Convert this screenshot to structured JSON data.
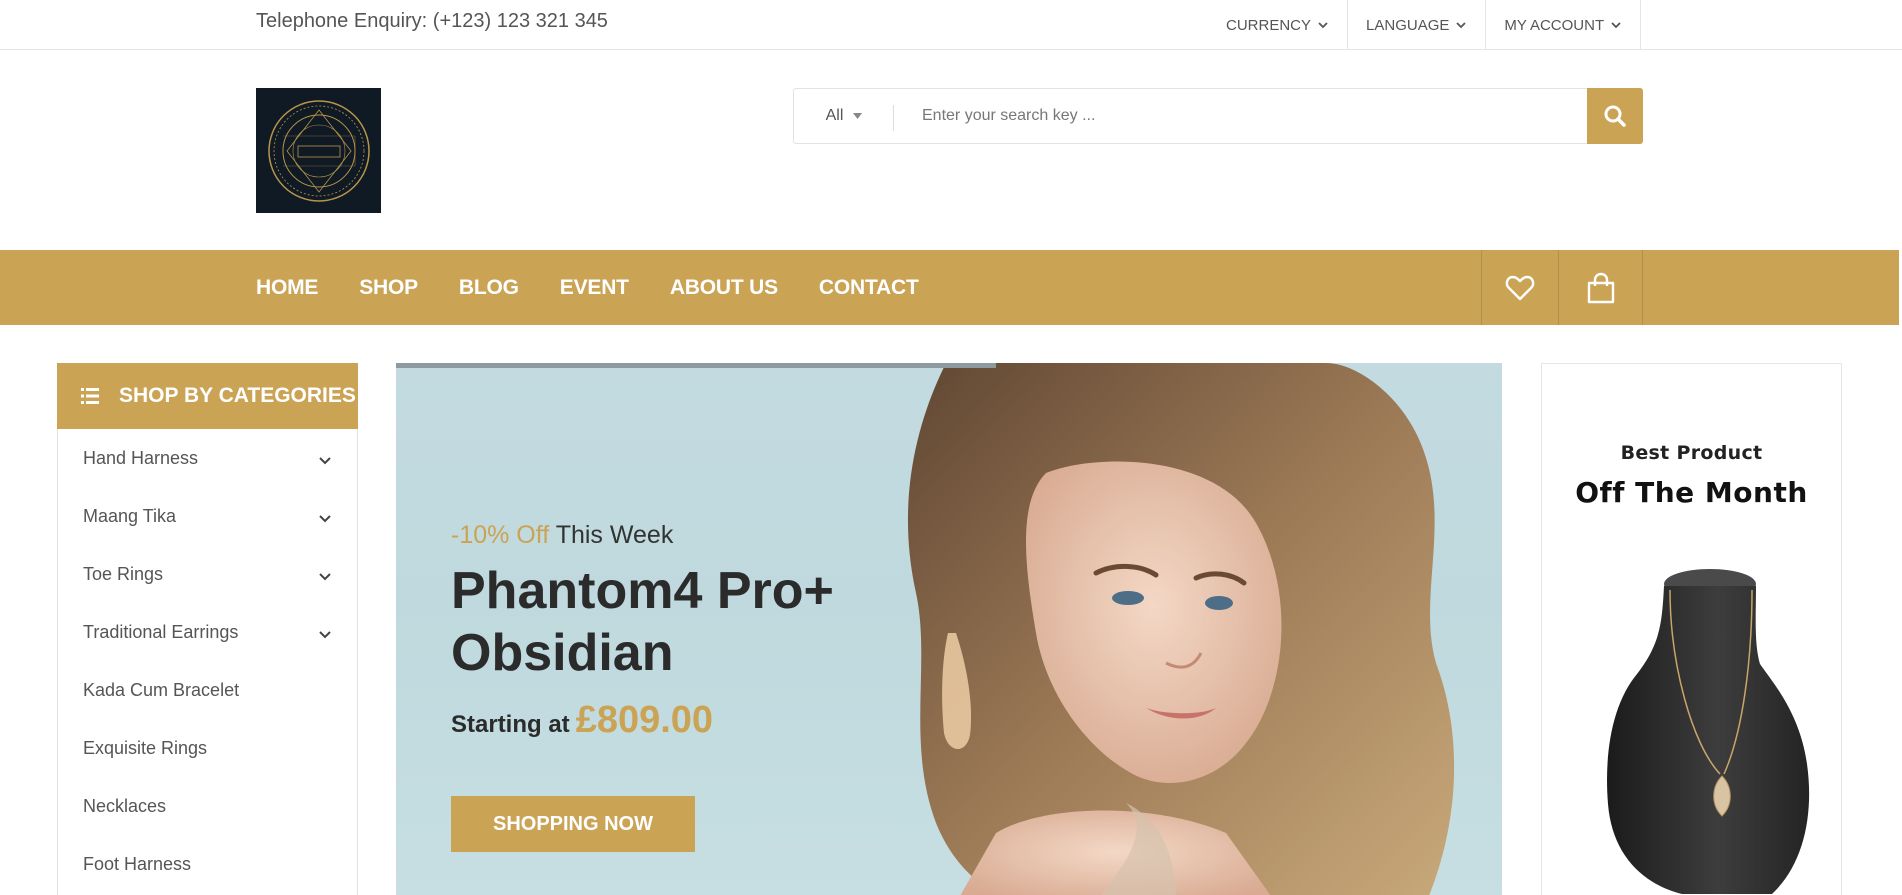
{
  "topbar": {
    "phone": "Telephone Enquiry: (+123) 123 321 345",
    "menus": [
      "CURRENCY",
      "LANGUAGE",
      "MY ACCOUNT"
    ]
  },
  "header": {
    "search": {
      "category": "All",
      "placeholder": "Enter your search key ..."
    }
  },
  "nav": {
    "items": [
      "HOME",
      "SHOP",
      "BLOG",
      "EVENT",
      "ABOUT US",
      "CONTACT"
    ]
  },
  "sidebar": {
    "title": "SHOP BY CATEGORIES",
    "items": [
      {
        "label": "Hand Harness",
        "has_children": true
      },
      {
        "label": "Maang Tika",
        "has_children": true
      },
      {
        "label": "Toe Rings",
        "has_children": true
      },
      {
        "label": "Traditional Earrings",
        "has_children": true
      },
      {
        "label": "Kada Cum Bracelet",
        "has_children": false
      },
      {
        "label": "Exquisite Rings",
        "has_children": false
      },
      {
        "label": "Necklaces",
        "has_children": false
      },
      {
        "label": "Foot Harness",
        "has_children": false
      }
    ]
  },
  "slider": {
    "discount": "-10% Off",
    "discount_suffix": "This Week",
    "headline": "Phantom4 Pro+ Obsidian",
    "starting_label": "Starting at",
    "price": "£809.00",
    "button": "SHOPPING NOW"
  },
  "banner": {
    "subtitle": "Best Product",
    "title": "Off The Month"
  },
  "colors": {
    "accent": "#cba355",
    "dark": "#2b2b2b",
    "slide_bg": "#c3dbe0"
  },
  "icons": {
    "search": "search-icon",
    "wishlist": "heart-icon",
    "cart": "shopping-bag-icon",
    "categories": "list-icon",
    "chevron": "chevron-down-icon"
  }
}
